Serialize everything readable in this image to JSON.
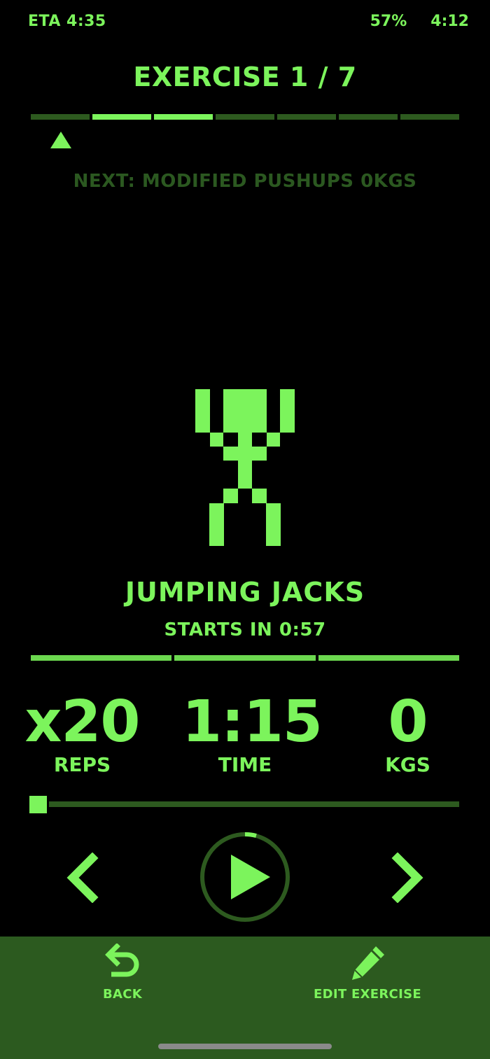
{
  "status": {
    "eta": "ETA 4:35",
    "battery": "57%",
    "time": "4:12"
  },
  "header": {
    "title": "EXERCISE 1 / 7",
    "exercise_count": 7,
    "current_exercise": 1
  },
  "next": {
    "text": "NEXT: MODIFIED PUSHUPS 0KGS"
  },
  "exercise": {
    "name": "JUMPING JACKS",
    "countdown": "STARTS IN 0:57",
    "figure_icon": "jumping-jacks-pixel-figure"
  },
  "stats": {
    "reps_value": "x20",
    "reps_label": "REPS",
    "time_value": "1:15",
    "time_label": "TIME",
    "kgs_value": "0",
    "kgs_label": "KGS"
  },
  "controls": {
    "prev_icon": "chevron-left-icon",
    "play_icon": "play-icon",
    "next_icon": "chevron-right-icon"
  },
  "bottom_bar": {
    "back_label": "BACK",
    "edit_label": "EDIT EXERCISE"
  },
  "colors": {
    "accent": "#7cf45c",
    "dim": "#2d5a1f",
    "bar": "#2c5a1f",
    "background": "#000000"
  }
}
